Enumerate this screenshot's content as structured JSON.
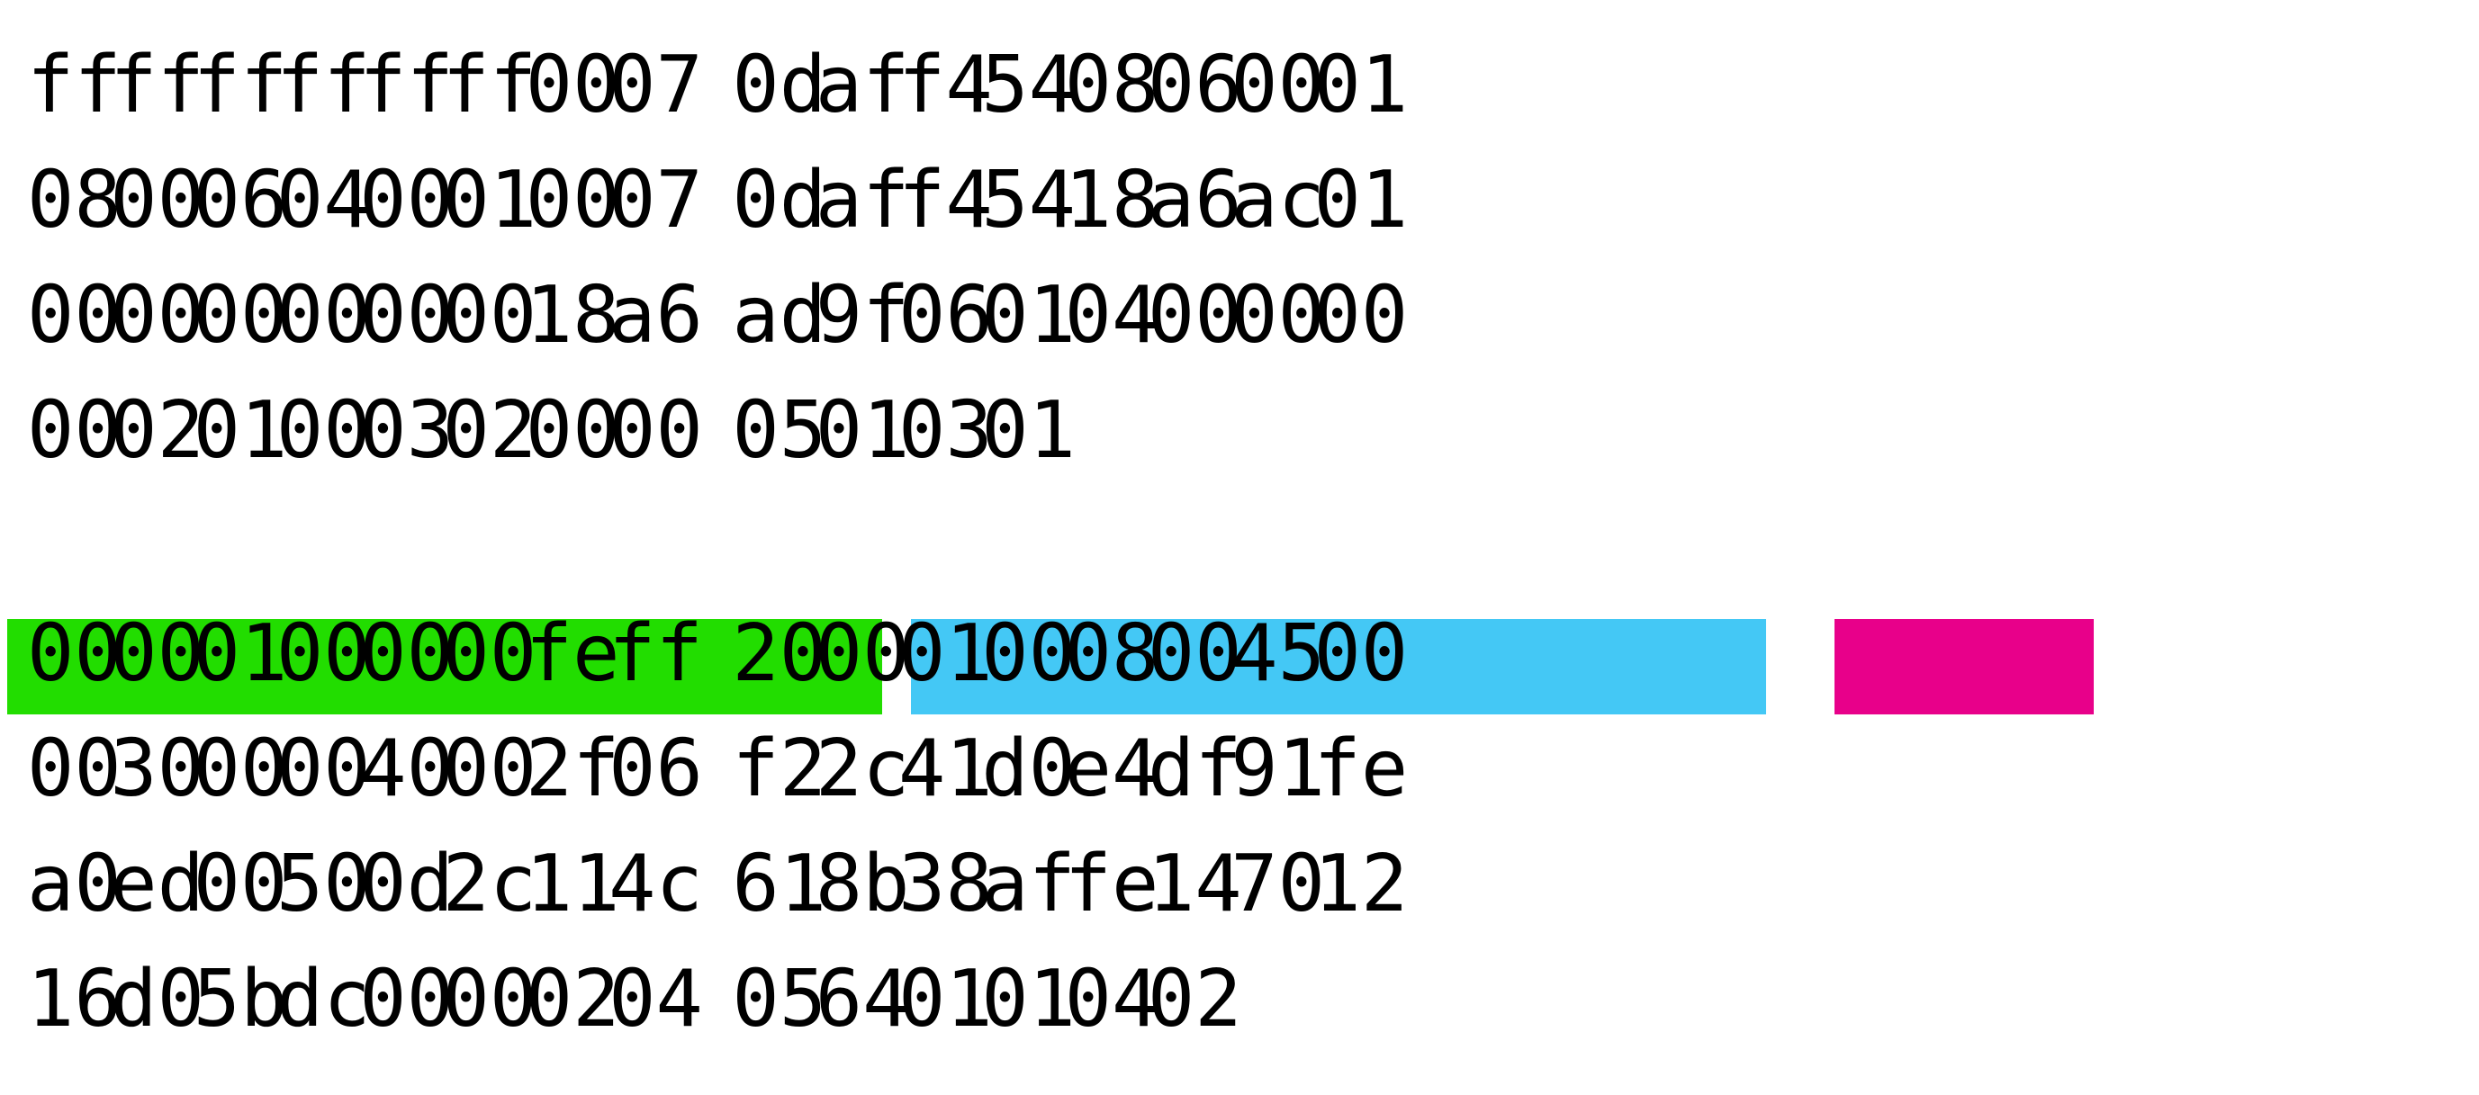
{
  "highlight_colors": {
    "green": "#22dd00",
    "blue": "#44c8f5",
    "pink": "#e8008a"
  },
  "blocks": [
    {
      "rows": [
        [
          "ff",
          "ff",
          "ff",
          "ff",
          "ff",
          "ff",
          "00",
          "07",
          "0d",
          "af",
          "f4",
          "54",
          "08",
          "06",
          "00",
          "01"
        ],
        [
          "08",
          "00",
          "06",
          "04",
          "00",
          "01",
          "00",
          "07",
          "0d",
          "af",
          "f4",
          "54",
          "18",
          "a6",
          "ac",
          "01"
        ],
        [
          "00",
          "00",
          "00",
          "00",
          "00",
          "00",
          "18",
          "a6",
          "ad",
          "9f",
          "06",
          "01",
          "04",
          "00",
          "00",
          "00"
        ],
        [
          "00",
          "02",
          "01",
          "00",
          "03",
          "02",
          "00",
          "00",
          "05",
          "01",
          "03",
          "01"
        ]
      ]
    },
    {
      "rows": [
        [
          "00",
          "00",
          "01",
          "00",
          "00",
          "00",
          "fe",
          "ff",
          "20",
          "00",
          "01",
          "00",
          "08",
          "00",
          "45",
          "00"
        ],
        [
          "00",
          "30",
          "00",
          "00",
          "40",
          "00",
          "2f",
          "06",
          "f2",
          "2c",
          "41",
          "d0",
          "e4",
          "df",
          "91",
          "fe"
        ],
        [
          "a0",
          "ed",
          "00",
          "50",
          "0d",
          "2c",
          "11",
          "4c",
          "61",
          "8b",
          "38",
          "af",
          "fe",
          "14",
          "70",
          "12"
        ],
        [
          "16",
          "d0",
          "5b",
          "dc",
          "00",
          "00",
          "02",
          "04",
          "05",
          "64",
          "01",
          "01",
          "04",
          "02"
        ]
      ]
    }
  ]
}
